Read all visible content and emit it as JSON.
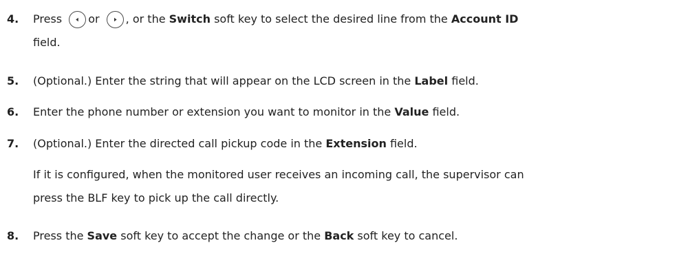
{
  "steps": [
    {
      "number": "4.",
      "press": "Press",
      "key_left_icon": "left-arrow-key-icon",
      "or": "or",
      "key_right_icon": "right-arrow-key-icon",
      "text_a": ", or the",
      "bold_a": "Switch",
      "text_b": "soft key to select the desired line from the",
      "bold_b": "Account ID",
      "continuation": "field."
    },
    {
      "number": "5.",
      "text_a": "(Optional.) Enter the string that will appear on the LCD screen in the",
      "bold_a": "Label",
      "text_b": "field."
    },
    {
      "number": "6.",
      "text_a": "Enter the phone number or extension you want to monitor in the",
      "bold_a": "Value",
      "text_b": "field."
    },
    {
      "number": "7.",
      "text_a": "(Optional.) Enter the directed call pickup code in the",
      "bold_a": "Extension",
      "text_b": "field.",
      "note_line1": "If it is configured, when the monitored user receives an incoming call, the supervisor can",
      "note_line2": "press the BLF key to pick up the call directly."
    },
    {
      "number": "8.",
      "text_a": "Press the",
      "bold_a": "Save",
      "text_b": "soft key to accept the change or the",
      "bold_b": "Back",
      "text_c": "soft key to cancel."
    }
  ]
}
